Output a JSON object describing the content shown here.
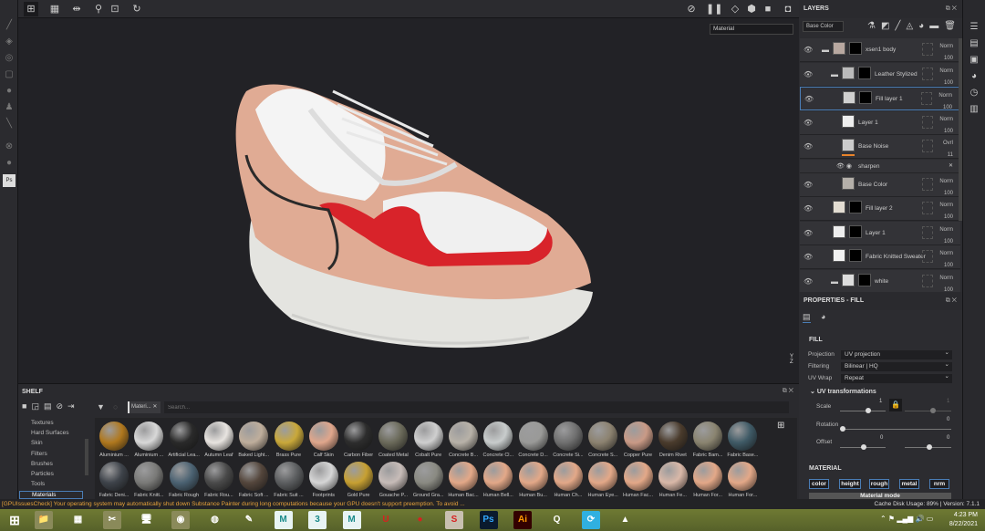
{
  "viewport": {
    "channel_select": "Material",
    "axis_labels": [
      "Y",
      "Z"
    ]
  },
  "layers": {
    "title": "LAYERS",
    "channel": "Base Color",
    "rows": [
      {
        "name": "xsen1 body",
        "blend": "Norm",
        "opacity": "100",
        "folder": true,
        "indent": 0,
        "thumb": "#b8a8a0"
      },
      {
        "name": "Leather Stylized",
        "blend": "Norm",
        "opacity": "100",
        "folder": true,
        "indent": 1,
        "thumb": "#bbb"
      },
      {
        "name": "Fill layer 1",
        "blend": "Norm",
        "opacity": "100",
        "folder": false,
        "indent": 2,
        "thumb": "#d0d0d0",
        "selected": true
      },
      {
        "name": "Layer 1",
        "blend": "Norm",
        "opacity": "100",
        "folder": false,
        "indent": 2,
        "thumb": "#eee"
      },
      {
        "name": "Base Noise",
        "blend": "Ovrl",
        "opacity": "11",
        "folder": false,
        "indent": 2,
        "thumb": "#ccc"
      },
      {
        "name": "Base Color",
        "blend": "Norm",
        "opacity": "100",
        "folder": false,
        "indent": 2,
        "thumb": "#b5b0aa"
      },
      {
        "name": "Fill layer 2",
        "blend": "Norm",
        "opacity": "100",
        "folder": false,
        "indent": 1,
        "thumb": "#e3ddd2"
      },
      {
        "name": "Layer 1",
        "blend": "Norm",
        "opacity": "100",
        "folder": false,
        "indent": 1,
        "thumb": "#eee"
      },
      {
        "name": "Fabric Knitted Sweater",
        "blend": "Norm",
        "opacity": "100",
        "folder": false,
        "indent": 1,
        "thumb": "#f2f2f2"
      },
      {
        "name": "white",
        "blend": "Norm",
        "opacity": "100",
        "folder": true,
        "indent": 1,
        "thumb": "#ddd"
      }
    ],
    "filter": {
      "name": "sharpen"
    }
  },
  "properties": {
    "title": "PROPERTIES - FILL",
    "section": "FILL",
    "projection": {
      "label": "Projection",
      "value": "UV projection"
    },
    "filtering": {
      "label": "Filtering",
      "value": "Bilinear | HQ"
    },
    "uvwrap": {
      "label": "UV Wrap",
      "value": "Repeat"
    },
    "uvtrans": "UV transformations",
    "scale": {
      "label": "Scale",
      "value": "1",
      "value2": "1"
    },
    "rotation": {
      "label": "Rotation",
      "value": "0"
    },
    "offset": {
      "label": "Offset",
      "value": "0",
      "value2": "0"
    },
    "material_section": "MATERIAL",
    "channels": [
      "color",
      "height",
      "rough",
      "metal",
      "nrm"
    ],
    "material_mode": "Material mode"
  },
  "shelf": {
    "title": "SHELF",
    "tag": "Materi...",
    "search_placeholder": "Search...",
    "categories": [
      "Textures",
      "Hard Surfaces",
      "Skin",
      "Filters",
      "Brushes",
      "Particles",
      "Tools",
      "Materials"
    ],
    "selected_category": "Materials",
    "materials": [
      {
        "name": "Aluminium ...",
        "color": "#b0781e"
      },
      {
        "name": "Aluminium ...",
        "color": "#d8d8d8"
      },
      {
        "name": "Artificial Lea...",
        "color": "#2a2a2a"
      },
      {
        "name": "Autumn Leaf",
        "color": "#e8e4e0"
      },
      {
        "name": "Baked Light...",
        "color": "#bfae9c"
      },
      {
        "name": "Brass Pure",
        "color": "#c9a83a"
      },
      {
        "name": "Calf Skin",
        "color": "#e0a68c"
      },
      {
        "name": "Carbon Fiber",
        "color": "#2d2d2d"
      },
      {
        "name": "Coated Metal",
        "color": "#6b6a5a"
      },
      {
        "name": "Cobalt Pure",
        "color": "#cfcfcf"
      },
      {
        "name": "Concrete B...",
        "color": "#b8b2a8"
      },
      {
        "name": "Concrete Cl...",
        "color": "#c8cccc"
      },
      {
        "name": "Concrete D...",
        "color": "#9a9a98"
      },
      {
        "name": "Concrete Si...",
        "color": "#707070"
      },
      {
        "name": "Concrete S...",
        "color": "#8c8270"
      },
      {
        "name": "Copper Pure",
        "color": "#c99a86"
      },
      {
        "name": "Denim Rivet",
        "color": "#4a3b2c"
      },
      {
        "name": "Fabric Bam...",
        "color": "#8a8470"
      },
      {
        "name": "Fabric Base...",
        "color": "#3f5a66"
      },
      {
        "name": "Fabric Deni...",
        "color": "#3e434a"
      },
      {
        "name": "Fabric Knitt...",
        "color": "#7a7a78"
      },
      {
        "name": "Fabric Rough",
        "color": "#4b6272"
      },
      {
        "name": "Fabric Rou...",
        "color": "#4a4a4a"
      },
      {
        "name": "Fabric Soft ...",
        "color": "#54463c"
      },
      {
        "name": "Fabric Suit ...",
        "color": "#5c5e60"
      },
      {
        "name": "Footprints",
        "color": "#d6d6d6"
      },
      {
        "name": "Gold Pure",
        "color": "#c7a032"
      },
      {
        "name": "Gouache P...",
        "color": "#c7bcb8"
      },
      {
        "name": "Ground Gra...",
        "color": "#8a8a82"
      },
      {
        "name": "Human Bac...",
        "color": "#e3a888"
      },
      {
        "name": "Human Bell...",
        "color": "#e3a888"
      },
      {
        "name": "Human Bu...",
        "color": "#e3a888"
      },
      {
        "name": "Human Ch...",
        "color": "#e3a888"
      },
      {
        "name": "Human Eye...",
        "color": "#e3a888"
      },
      {
        "name": "Human Fac...",
        "color": "#e3a888"
      },
      {
        "name": "Human Fe...",
        "color": "#d9b8a8"
      },
      {
        "name": "Human For...",
        "color": "#e3a888"
      },
      {
        "name": "Human For...",
        "color": "#e3a888"
      }
    ]
  },
  "status": {
    "warning": "[GPUIssuesCheck] Your operating system may automatically shut down Substance Painter during long computations because your GPU doesn't support preemption. To avoid ...",
    "cache": "Cache Disk Usage:   89% | Version: 7.1.1",
    "warning_color": "#e8a33a"
  },
  "taskbar": {
    "time": "4:23 PM",
    "date": "8/22/2021",
    "apps": [
      {
        "icon": "file-explorer",
        "glyph": "📁",
        "bg": "#8a8a5a"
      },
      {
        "icon": "calculator",
        "glyph": "▦",
        "bg": "transparent"
      },
      {
        "icon": "snipping-tool",
        "glyph": "✂",
        "bg": "#8a8a5a"
      },
      {
        "icon": "remote-desktop",
        "glyph": "🖥",
        "bg": "transparent"
      },
      {
        "icon": "chrome",
        "glyph": "◉",
        "bg": "#8a8a5a"
      },
      {
        "icon": "idm",
        "glyph": "◍",
        "bg": "transparent"
      },
      {
        "icon": "tool",
        "glyph": "✎",
        "bg": "transparent"
      },
      {
        "icon": "maya",
        "glyph": "M",
        "bg": "#e8f4f4"
      },
      {
        "icon": "3ds-max",
        "glyph": "3",
        "bg": "#e8f4f4"
      },
      {
        "icon": "maya-2",
        "glyph": "M",
        "bg": "#e8f4f4"
      },
      {
        "icon": "ubisoft",
        "glyph": "U",
        "bg": "transparent"
      },
      {
        "icon": "app-red",
        "glyph": "●",
        "bg": "transparent"
      },
      {
        "icon": "substance-painter",
        "glyph": "S",
        "bg": "#c9c0b0"
      },
      {
        "icon": "photoshop",
        "glyph": "Ps",
        "bg": "#0a1a2e"
      },
      {
        "icon": "illustrator",
        "glyph": "Ai",
        "bg": "#330000"
      },
      {
        "icon": "app-q",
        "glyph": "Q",
        "bg": "transparent"
      },
      {
        "icon": "app-sync",
        "glyph": "⟳",
        "bg": "#30b0e0"
      },
      {
        "icon": "vlc",
        "glyph": "▲",
        "bg": "transparent"
      }
    ]
  }
}
